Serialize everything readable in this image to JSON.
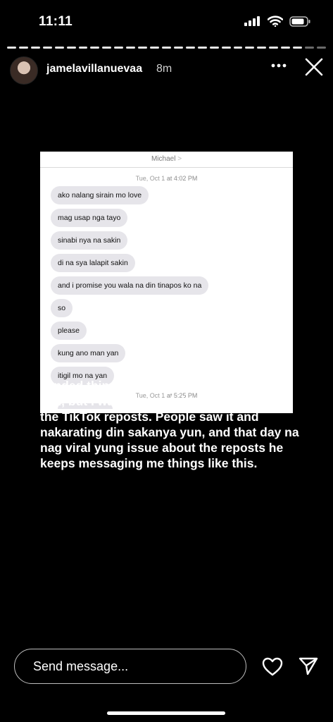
{
  "status_bar": {
    "time": "11:11"
  },
  "story": {
    "progress_segments": 27,
    "progress_viewed": 25,
    "username": "jamelavillanuevaa",
    "time_ago": "8m"
  },
  "screenshot": {
    "contact": "Michael",
    "contact_chevron": ">",
    "timestamp1_day": "Tue, Oct 1",
    "timestamp1_time": "at 4:02 PM",
    "messages": [
      "ako nalang sirain mo love",
      "mag usap nga tayo",
      "sinabi nya na sakin",
      "di na sya lalapit sakin",
      "and i promise you wala na din tinapos ko na",
      "so",
      "please",
      "kung ano man yan",
      "itigil mo na yan"
    ],
    "timestamp2_day": "Tue, Oct 1",
    "timestamp2_time": "at 5:25 PM"
  },
  "caption": "I ended things with him as peacefully as I can, but I was hurt and devastated hence the TikTok reposts. People saw it and nakarating din sakanya yun, and that day na nag viral yung issue about the reposts he keeps messaging me things like this.",
  "reply": {
    "placeholder": "Send message..."
  },
  "icons": {
    "signal": "signal-icon",
    "wifi": "wifi-icon",
    "battery": "battery-icon",
    "more": "more-icon",
    "close": "close-icon",
    "heart": "heart-icon",
    "send": "send-icon"
  }
}
